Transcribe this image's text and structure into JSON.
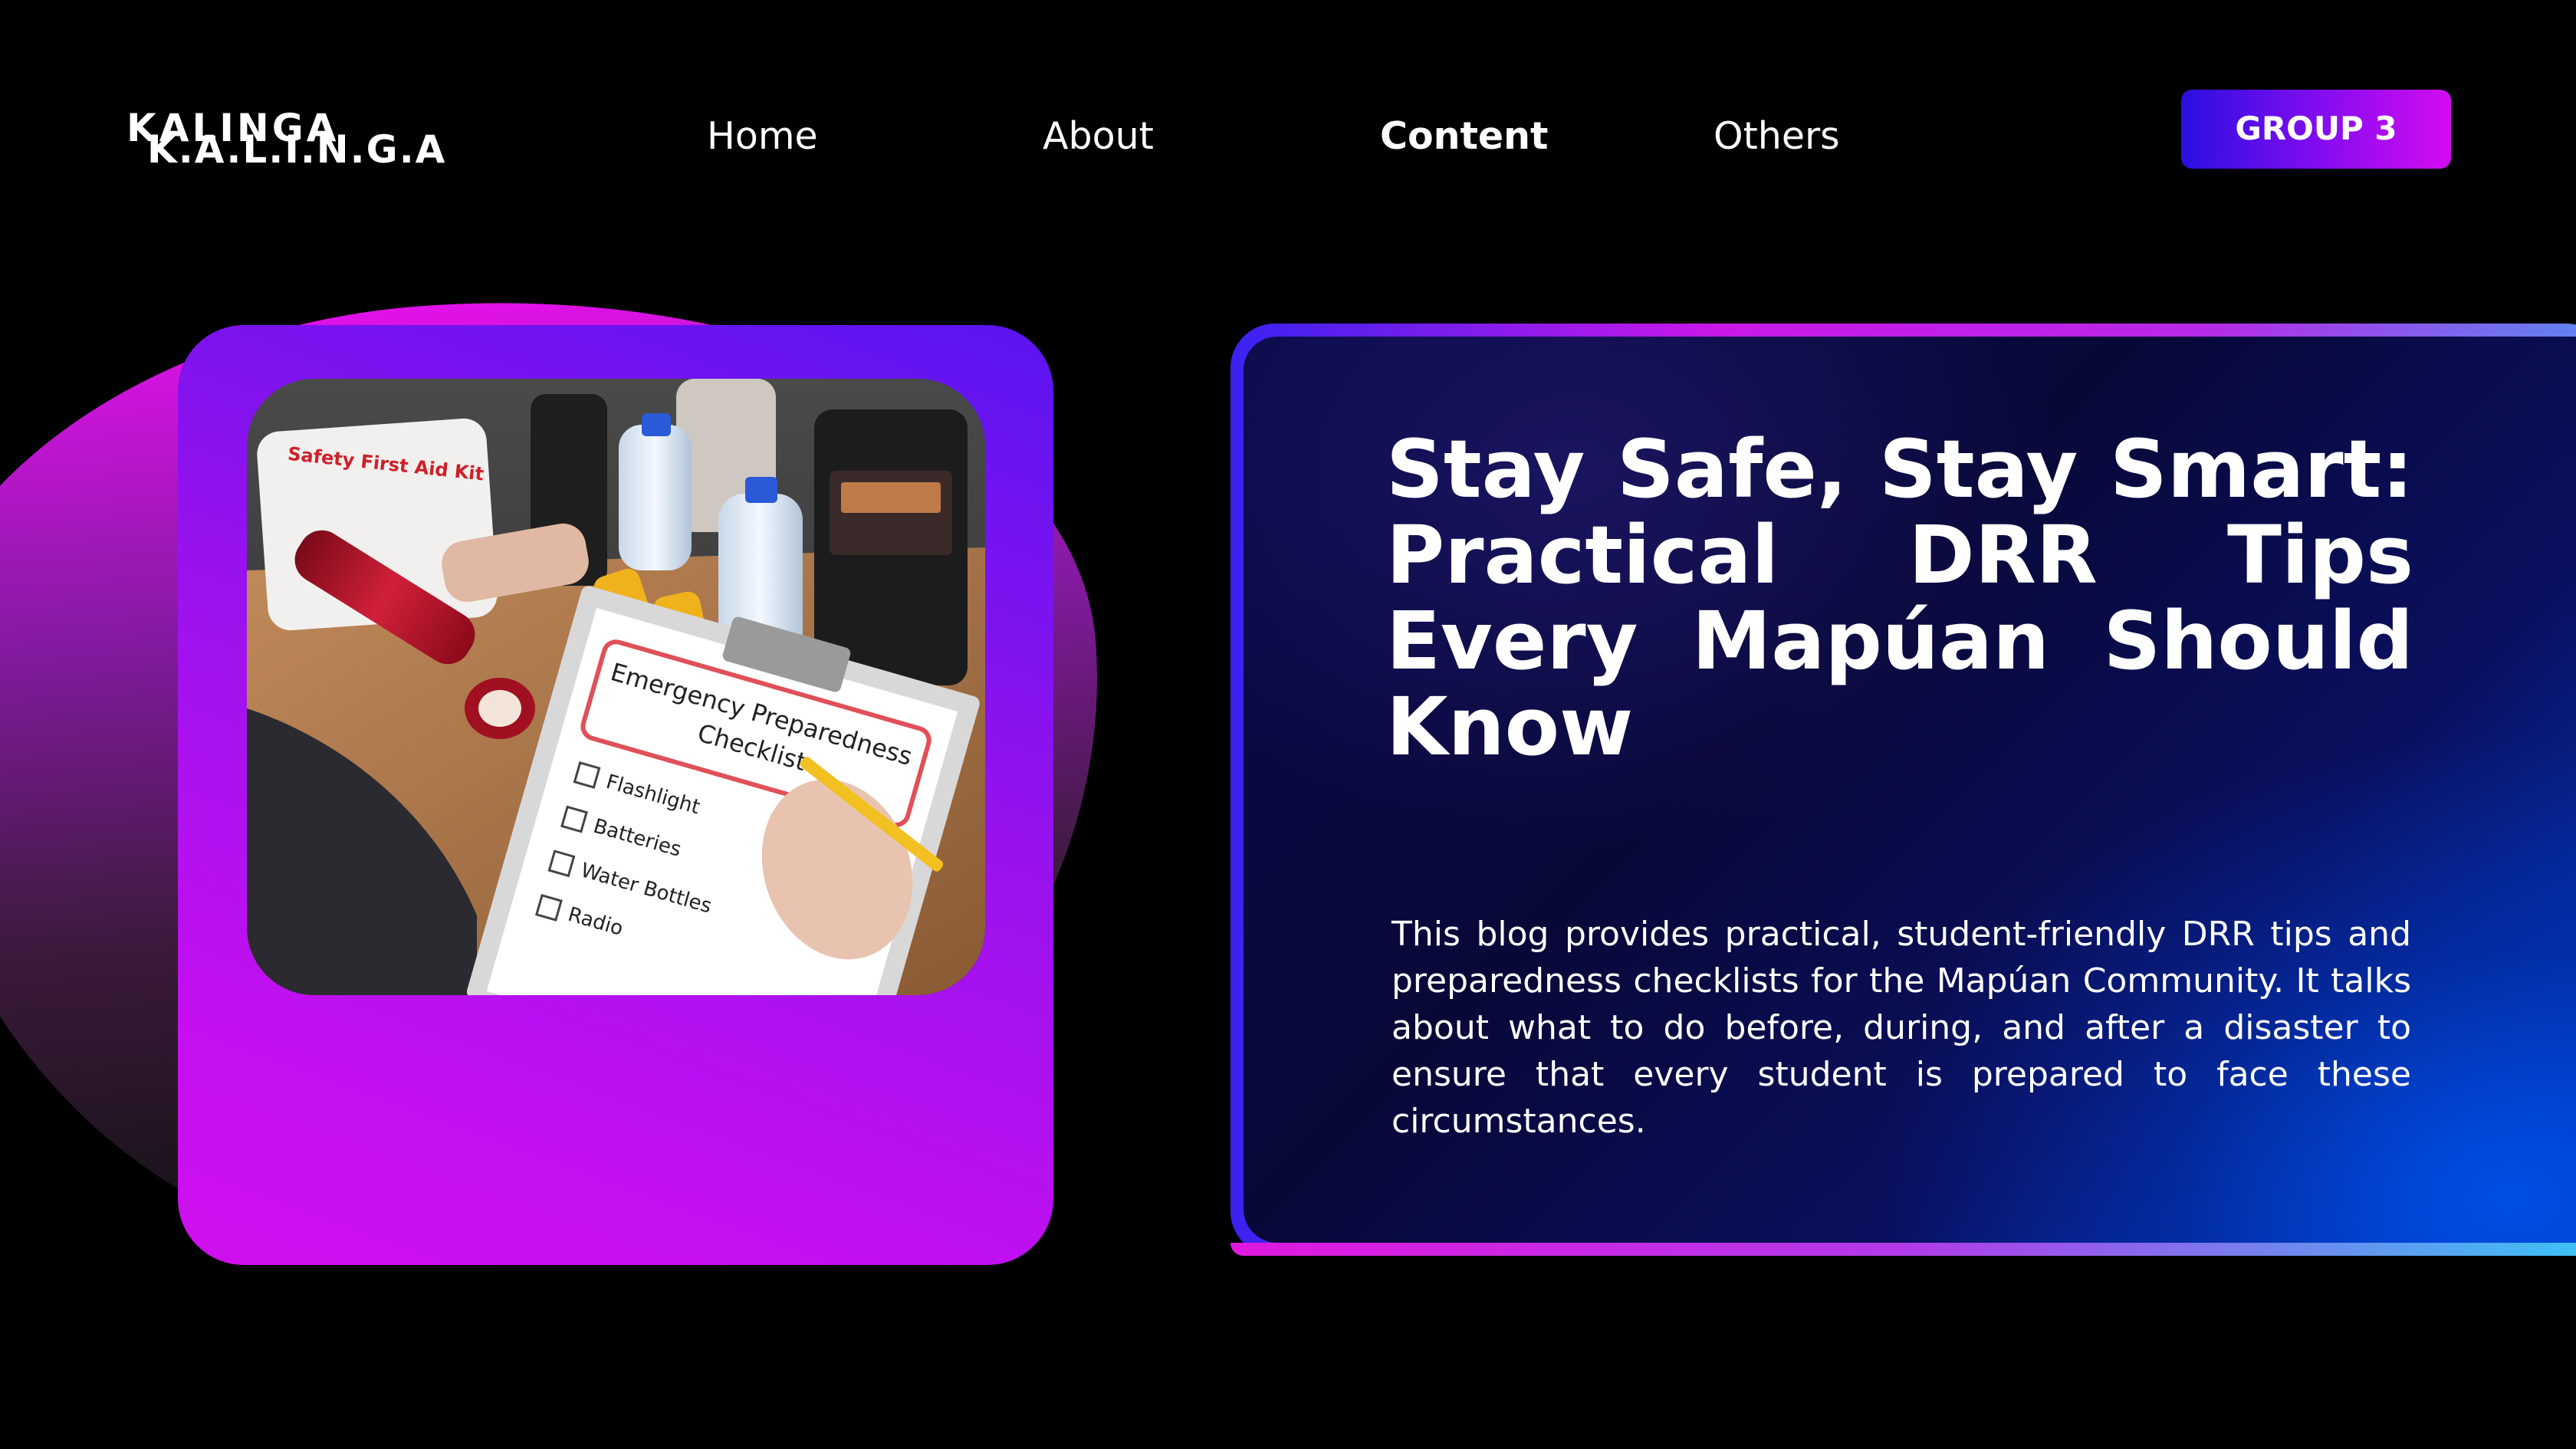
{
  "header": {
    "logo_line1": "KALINGA",
    "logo_line2": "K.A.L.I.N.G.A",
    "nav": {
      "home": "Home",
      "about": "About",
      "content": "Content",
      "others": "Others"
    },
    "active_nav": "content",
    "group_button": "GROUP 3"
  },
  "hero_image": {
    "kit_label": "Safety First Aid Kit",
    "checklist_title_line1": "Emergency Preparedness",
    "checklist_title_line2": "Checklist",
    "checklist_items": [
      "Flashlight",
      "Batteries",
      "Water Bottles",
      "Radio"
    ]
  },
  "article": {
    "title": "Stay Safe, Stay Smart: Practical DRR Tips Every Mapúan Should Know",
    "description": "This blog provides practical, student-friendly DRR tips and preparedness checklists for the Mapúan Community. It talks about what to do before, during, and after a disaster to ensure that every student is prepared to face these circumstances."
  },
  "colors": {
    "background": "#000000",
    "accent_purple": "#9a12ee",
    "accent_magenta": "#d010ee",
    "accent_blue": "#2a10e0",
    "panel_blue": "#0040d0",
    "text": "#ffffff"
  }
}
